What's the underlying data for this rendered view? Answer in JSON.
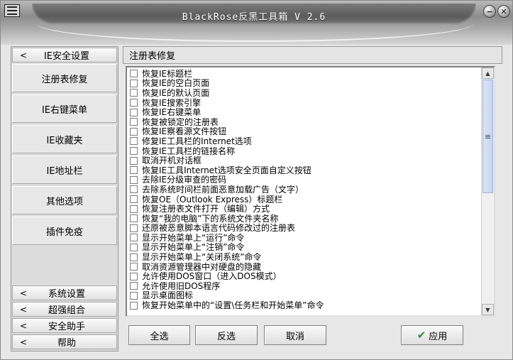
{
  "window": {
    "title": "BlackRose反黑工具箱 V 2.6",
    "minimize_glyph": "−",
    "close_glyph": "✕"
  },
  "sidebar": {
    "top_group": "IE安全设置",
    "items": [
      "注册表修复",
      "IE右键菜单",
      "IE收藏夹",
      "IE地址栏",
      "其他选项",
      "插件免疫"
    ],
    "bottom_groups": [
      "系统设置",
      "超强组合",
      "安全助手",
      "帮助"
    ]
  },
  "panel": {
    "title": "注册表修复",
    "options": [
      "恢复IE标题栏",
      "恢复IE的空白页面",
      "恢复IE的默认页面",
      "恢复IE搜索引擎",
      "恢复IE右键菜单",
      "恢复被锁定的注册表",
      "恢复IE察看源文件按钮",
      "修复IE工具栏的Internet选项",
      "恢复IE工具栏的链接名称",
      "取消开机对话框",
      "恢复IE工具Internet选项安全页面自定义按钮",
      "去除IE分级审查的密码",
      "去除系统时间栏前面恶意加载广告（文字）",
      "恢复OE（Outlook Express）标题栏",
      "恢复注册表文件打开（编辑）方式",
      "恢复“我的电脑”下的系统文件夹名称",
      "还原被恶意脚本语言代码修改过的注册表",
      "显示开始菜单上“运行”命令",
      "显示开始菜单上“注销”命令",
      "显示开始菜单上“关闭系统”命令",
      "取消资源管理器中对硬盘的隐藏",
      "允许使用DOS窗口（进入DOS模式）",
      "允许使用旧DOS程序",
      "显示桌面图标",
      "恢复开始菜单中的“设置\\任务栏和开始菜单”命令"
    ]
  },
  "buttons": {
    "select_all": "全选",
    "invert": "反选",
    "cancel": "取消",
    "apply": "应用"
  },
  "colors": {
    "window_bg": "#e7e7e7",
    "title_text": "#ffffff",
    "apply_check": "#2a8a2a"
  }
}
